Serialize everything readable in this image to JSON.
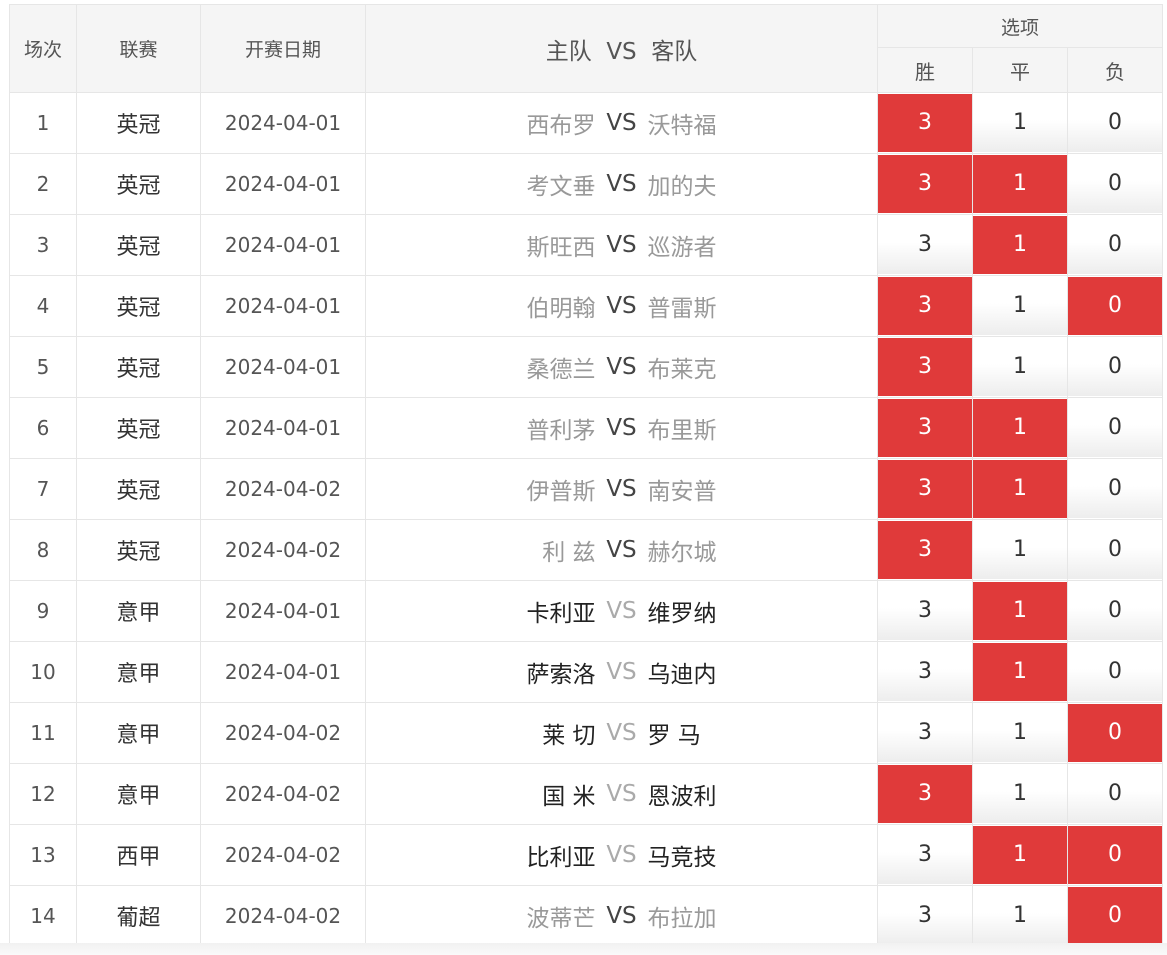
{
  "headers": {
    "no": "场次",
    "league": "联赛",
    "date": "开赛日期",
    "teams": "主队  VS  客队",
    "options": "选项",
    "win": "胜",
    "draw": "平",
    "lose": "负"
  },
  "vs_label": "VS",
  "colors": {
    "selected": "#e03a3a",
    "header_bg": "#f5f5f5",
    "muted_team": "#999999"
  },
  "rows": [
    {
      "no": "1",
      "league": "英冠",
      "date": "2024-04-01",
      "home": "西布罗",
      "away": "沃特福",
      "style": "muted",
      "win": "3",
      "draw": "1",
      "lose": "0",
      "sel": [
        true,
        false,
        false
      ]
    },
    {
      "no": "2",
      "league": "英冠",
      "date": "2024-04-01",
      "home": "考文垂",
      "away": "加的夫",
      "style": "muted",
      "win": "3",
      "draw": "1",
      "lose": "0",
      "sel": [
        true,
        true,
        false
      ]
    },
    {
      "no": "3",
      "league": "英冠",
      "date": "2024-04-01",
      "home": "斯旺西",
      "away": "巡游者",
      "style": "muted",
      "win": "3",
      "draw": "1",
      "lose": "0",
      "sel": [
        false,
        true,
        false
      ]
    },
    {
      "no": "4",
      "league": "英冠",
      "date": "2024-04-01",
      "home": "伯明翰",
      "away": "普雷斯",
      "style": "muted",
      "win": "3",
      "draw": "1",
      "lose": "0",
      "sel": [
        true,
        false,
        true
      ]
    },
    {
      "no": "5",
      "league": "英冠",
      "date": "2024-04-01",
      "home": "桑德兰",
      "away": "布莱克",
      "style": "muted",
      "win": "3",
      "draw": "1",
      "lose": "0",
      "sel": [
        true,
        false,
        false
      ]
    },
    {
      "no": "6",
      "league": "英冠",
      "date": "2024-04-01",
      "home": "普利茅",
      "away": "布里斯",
      "style": "muted",
      "win": "3",
      "draw": "1",
      "lose": "0",
      "sel": [
        true,
        true,
        false
      ]
    },
    {
      "no": "7",
      "league": "英冠",
      "date": "2024-04-02",
      "home": "伊普斯",
      "away": "南安普",
      "style": "muted",
      "win": "3",
      "draw": "1",
      "lose": "0",
      "sel": [
        true,
        true,
        false
      ]
    },
    {
      "no": "8",
      "league": "英冠",
      "date": "2024-04-02",
      "home": "利 兹",
      "away": "赫尔城",
      "style": "muted",
      "win": "3",
      "draw": "1",
      "lose": "0",
      "sel": [
        true,
        false,
        false
      ]
    },
    {
      "no": "9",
      "league": "意甲",
      "date": "2024-04-01",
      "home": "卡利亚",
      "away": "维罗纳",
      "style": "dark",
      "win": "3",
      "draw": "1",
      "lose": "0",
      "sel": [
        false,
        true,
        false
      ]
    },
    {
      "no": "10",
      "league": "意甲",
      "date": "2024-04-01",
      "home": "萨索洛",
      "away": "乌迪内",
      "style": "dark",
      "win": "3",
      "draw": "1",
      "lose": "0",
      "sel": [
        false,
        true,
        false
      ]
    },
    {
      "no": "11",
      "league": "意甲",
      "date": "2024-04-02",
      "home": "莱 切",
      "away": "罗 马",
      "style": "dark",
      "win": "3",
      "draw": "1",
      "lose": "0",
      "sel": [
        false,
        false,
        true
      ]
    },
    {
      "no": "12",
      "league": "意甲",
      "date": "2024-04-02",
      "home": "国 米",
      "away": "恩波利",
      "style": "dark",
      "win": "3",
      "draw": "1",
      "lose": "0",
      "sel": [
        true,
        false,
        false
      ]
    },
    {
      "no": "13",
      "league": "西甲",
      "date": "2024-04-02",
      "home": "比利亚",
      "away": "马竞技",
      "style": "dark",
      "win": "3",
      "draw": "1",
      "lose": "0",
      "sel": [
        false,
        true,
        true
      ]
    },
    {
      "no": "14",
      "league": "葡超",
      "date": "2024-04-02",
      "home": "波蒂芒",
      "away": "布拉加",
      "style": "muted",
      "win": "3",
      "draw": "1",
      "lose": "0",
      "sel": [
        false,
        false,
        true
      ]
    }
  ]
}
